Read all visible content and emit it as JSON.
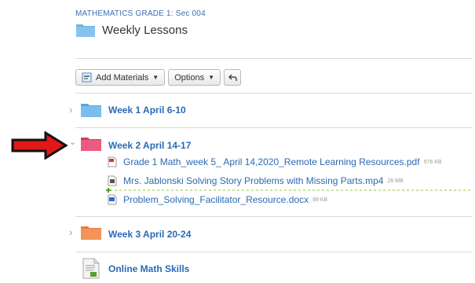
{
  "header": {
    "course": "MATHEMATICS GRADE 1: Sec 004",
    "title": "Weekly Lessons"
  },
  "toolbar": {
    "add_materials": "Add Materials",
    "options": "Options"
  },
  "folders": [
    {
      "label": "Week 1 April 6-10",
      "color": "#6fb3e6"
    },
    {
      "label": "Week 2 April 14-17",
      "color": "#e0476e"
    },
    {
      "label": "Week 3 April 20-24",
      "color": "#ef8a4e"
    }
  ],
  "files": [
    {
      "name": "Grade 1 Math_week 5_ April 14,2020_Remote Learning Resources.pdf",
      "size": "976 KB",
      "type": "pdf"
    },
    {
      "name": "Mrs. Jablonski Solving Story Problems with Missing Parts.mp4",
      "size": "26 MB",
      "type": "video"
    },
    {
      "name": "Problem_Solving_Facilitator_Resource.docx",
      "size": "89 KB",
      "type": "doc"
    }
  ],
  "link_item": {
    "label": "Online Math Skills"
  },
  "colors": {
    "link": "#2a6ab3",
    "arrow": "#e01818",
    "dashed": "#8dc63f"
  }
}
